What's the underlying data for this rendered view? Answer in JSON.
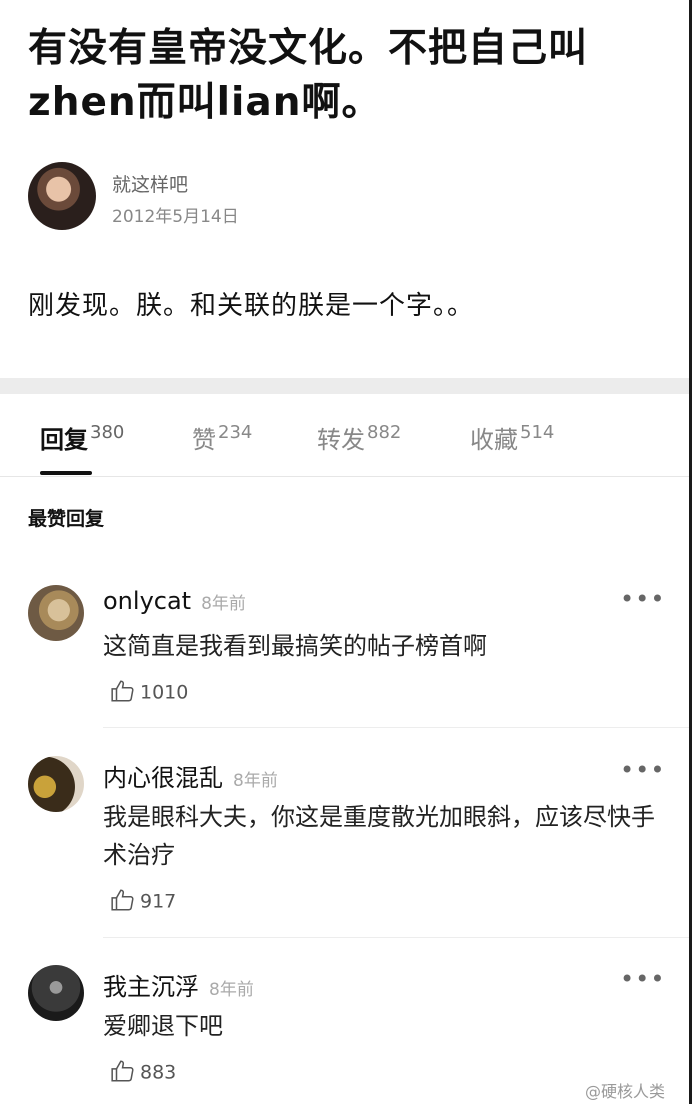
{
  "post": {
    "title": "有没有皇帝没文化。不把自己叫zhen而叫lian啊。",
    "author": "就这样吧",
    "date": "2012年5月14日",
    "body": "刚发现。朕。和关联的朕是一个字。。"
  },
  "tabs": [
    {
      "label": "回复",
      "count": "380",
      "active": true
    },
    {
      "label": "赞",
      "count": "234"
    },
    {
      "label": "转发",
      "count": "882"
    },
    {
      "label": "收藏",
      "count": "514"
    }
  ],
  "section_title": "最赞回复",
  "comments": [
    {
      "user": "onlycat",
      "time": "8年前",
      "text": "这简直是我看到最搞笑的帖子榜首啊",
      "likes": "1010",
      "avatar_icon": "cat-avatar"
    },
    {
      "user": "内心很混乱",
      "time": "8年前",
      "text": "我是眼科大夫，你这是重度散光加眼斜，应该尽快手术治疗",
      "likes": "917",
      "avatar_icon": "user-avatar"
    },
    {
      "user": "我主沉浮",
      "time": "8年前",
      "text": "爱卿退下吧",
      "likes": "883",
      "avatar_icon": "user-avatar"
    }
  ],
  "more_glyph": "•••",
  "watermark": "@硬核人类",
  "colors": {
    "accent": "#111111",
    "muted": "#888888",
    "gap": "#ececec"
  }
}
